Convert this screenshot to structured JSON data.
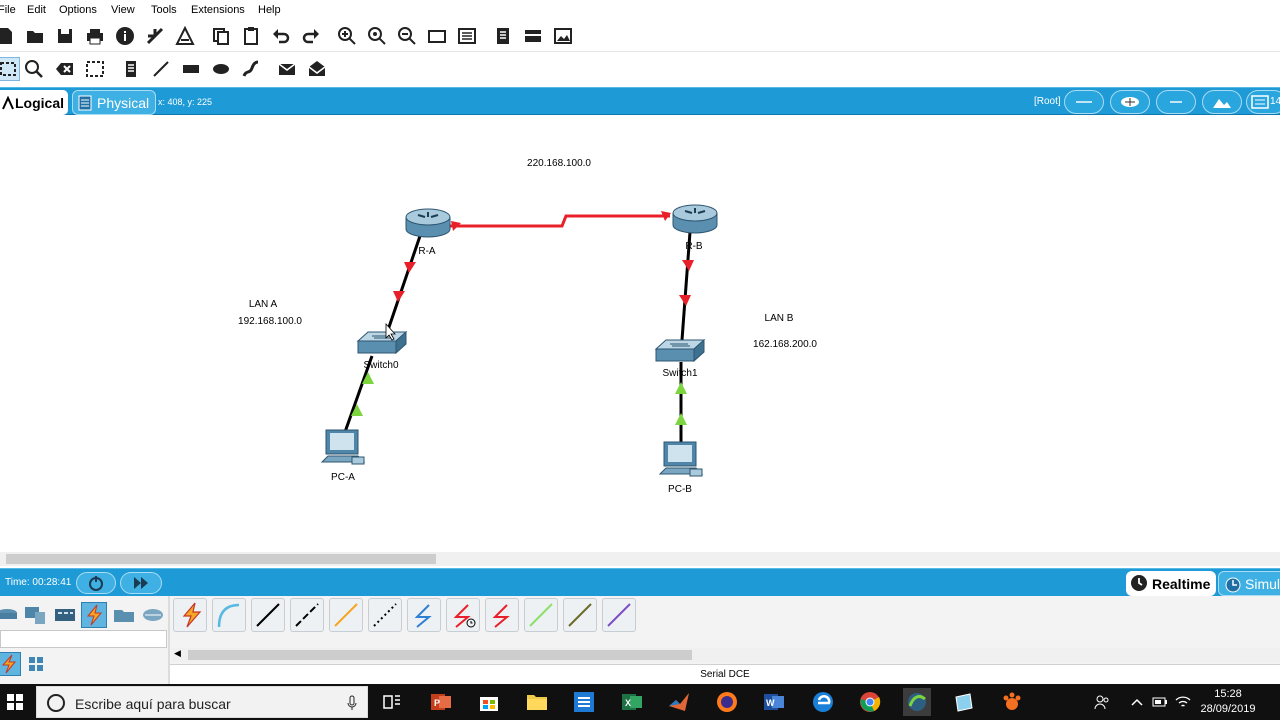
{
  "menu": {
    "items": [
      "File",
      "Edit",
      "Options",
      "View",
      "Tools",
      "Extensions",
      "Help"
    ]
  },
  "modebar": {
    "logical": "Logical",
    "physical": "Physical",
    "coords": "x: 408, y: 225",
    "root": "[Root]",
    "counter": "14"
  },
  "topology": {
    "wan_label": "220.168.100.0",
    "lan_a_title": "LAN A",
    "lan_a_net": "192.168.100.0",
    "lan_b_title": "LAN B",
    "lan_b_net": "162.168.200.0",
    "router_a": "R-A",
    "router_b": "R-B",
    "switch0": "Switch0",
    "switch1": "Switch1",
    "pc_a": "PC-A",
    "pc_b": "PC-B",
    "colors": {
      "serial": "#e8202a",
      "ethernet": "#000000",
      "link_up": "#7cd43f",
      "link_down": "#e8202a"
    }
  },
  "timebar": {
    "time": "Time: 00:28:41",
    "realtime": "Realtime",
    "simulation": "Simul"
  },
  "palette": {
    "status": "Serial DCE",
    "connections": [
      "automatic-icon",
      "console-icon",
      "copper-straight-icon",
      "copper-cross-icon",
      "fiber-icon",
      "phone-icon",
      "coaxial-icon",
      "serial-dce-icon",
      "serial-dte-icon",
      "octal-icon",
      "iot-icon",
      "usb-icon"
    ]
  },
  "taskbar": {
    "search_placeholder": "Escribe aquí para buscar",
    "time": "15:28",
    "date": "28/09/2019"
  }
}
